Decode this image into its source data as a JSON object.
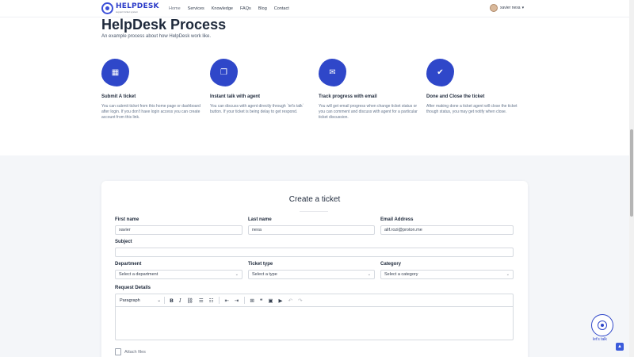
{
  "brand": {
    "name": "HELPDESK",
    "tagline": "support ticket system"
  },
  "nav": {
    "items": [
      "Home",
      "Services",
      "Knowledge",
      "FAQs",
      "Blog",
      "Contact"
    ]
  },
  "user": {
    "name": "xavier nexa"
  },
  "process": {
    "title": "HelpDesk Process",
    "subtitle": "An example process about how HelpDesk work like.",
    "steps": [
      {
        "icon": "ticket-icon",
        "title": "Submit A ticket",
        "text": "You can submit ticket from this home page or dashboard after login. If you don't have login access you can create account from this link."
      },
      {
        "icon": "chat-icon",
        "title": "Instant talk with agent",
        "text": "You can discuss with agent directly through `let's talk` button. If your ticket is being delay to get respond."
      },
      {
        "icon": "email-icon",
        "title": "Track progress with email",
        "text": "You will get email progress when change ticket status or you can comment and discuss with agent for a particular ticket discussion."
      },
      {
        "icon": "check-icon",
        "title": "Done and Close the ticket",
        "text": "After making done a ticket agent will close the ticket though status, you may get notify when close."
      }
    ]
  },
  "form": {
    "title": "Create a ticket",
    "first_name": {
      "label": "First name",
      "value": "xavier"
    },
    "last_name": {
      "label": "Last name",
      "value": "nexa"
    },
    "email": {
      "label": "Email Address",
      "value": "alif.rozi@proton.me"
    },
    "subject": {
      "label": "Subject",
      "value": ""
    },
    "department": {
      "label": "Department",
      "value": "Select a department"
    },
    "ticket_type": {
      "label": "Ticket type",
      "value": "Select a type"
    },
    "category": {
      "label": "Category",
      "value": "Select a category"
    },
    "details": {
      "label": "Request Details",
      "paragraph": "Paragraph"
    },
    "attach_label": "Attach files"
  },
  "talk": {
    "label": "let's talk"
  },
  "colors": {
    "accent": "#2f47c9",
    "section_bg": "#f4f6f9"
  }
}
